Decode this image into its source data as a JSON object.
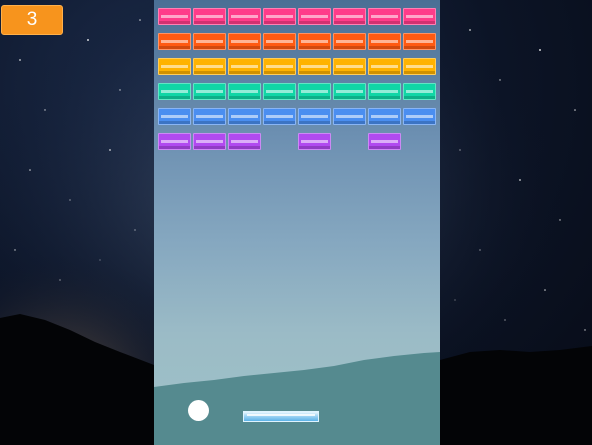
{
  "score": "3",
  "colors": {
    "pink": "#ff3c8a",
    "orange": "#ff5a12",
    "yellow": "#ffb300",
    "teal": "#10d6a6",
    "blue": "#4a8ef0",
    "purple": "#b14af0"
  },
  "bricks": [
    {
      "row": 0,
      "color": "pink",
      "present": [
        true,
        true,
        true,
        true,
        true,
        true,
        true,
        true
      ]
    },
    {
      "row": 1,
      "color": "orange",
      "present": [
        true,
        true,
        true,
        true,
        true,
        true,
        true,
        true
      ]
    },
    {
      "row": 2,
      "color": "yellow",
      "present": [
        true,
        true,
        true,
        true,
        true,
        true,
        true,
        true
      ]
    },
    {
      "row": 3,
      "color": "teal",
      "present": [
        true,
        true,
        true,
        true,
        true,
        true,
        true,
        true
      ]
    },
    {
      "row": 4,
      "color": "blue",
      "present": [
        true,
        true,
        true,
        true,
        true,
        true,
        true,
        true
      ]
    },
    {
      "row": 5,
      "color": "purple",
      "present": [
        true,
        true,
        true,
        false,
        true,
        false,
        true,
        false
      ]
    }
  ]
}
